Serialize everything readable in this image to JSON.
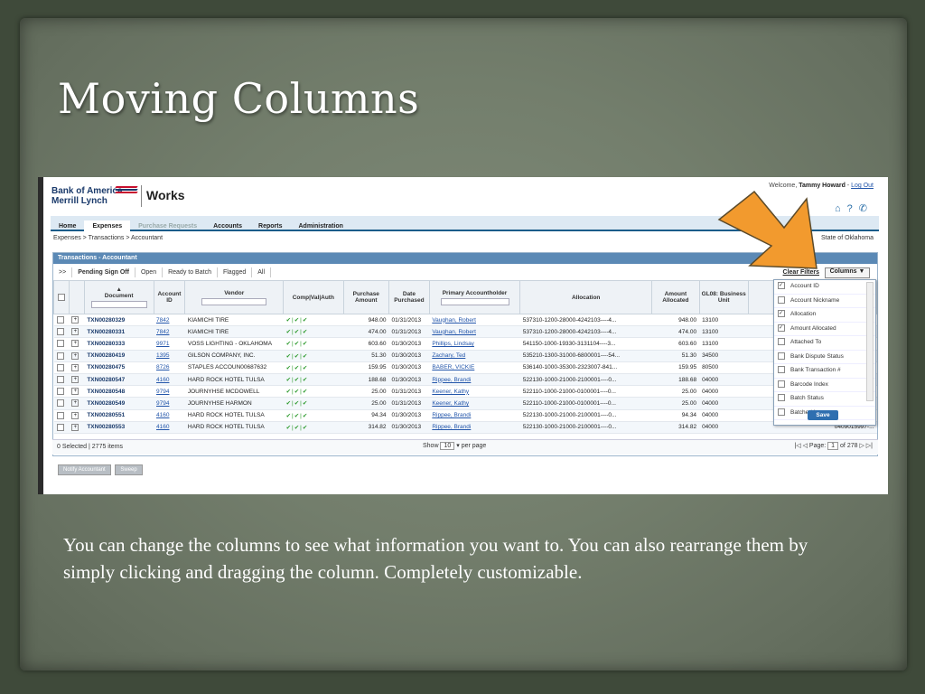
{
  "slide": {
    "title": "Moving Columns",
    "caption": "You can change the columns to see what information you want to. You can also rearrange them by simply clicking and dragging the column. Completely customizable."
  },
  "app": {
    "brand_line1": "Bank of America",
    "brand_line2": "Merrill Lynch",
    "product": "Works",
    "welcome_prefix": "Welcome,",
    "user": "Tammy Howard",
    "logout": "Log Out",
    "nav": [
      "Home",
      "Expenses",
      "Purchase Requests",
      "Accounts",
      "Reports",
      "Administration"
    ],
    "breadcrumb": "Expenses > Transactions > Accountant",
    "state": "State of Oklahoma",
    "panel_title": "Transactions - Accountant",
    "subtabs": [
      ">>",
      "Pending Sign Off",
      "Open",
      "Ready to Batch",
      "Flagged",
      "All"
    ],
    "clear_filters": "Clear Filters",
    "columns_button": "Columns ▼",
    "headers": [
      "Document",
      "Account ID",
      "Vendor",
      "Comp|Val|Auth",
      "Purchase Amount",
      "Date Purchased",
      "Primary Accountholder",
      "Allocation",
      "Amount Allocated",
      "GL08: Business Unit"
    ],
    "rows": [
      [
        "TXN00280329",
        "7842",
        "KIAMICHI TIRE",
        "948.00",
        "01/31/2013",
        "Vaughan, Robert",
        "537310-1200-28000-4242103----4...",
        "948.00",
        "13100"
      ],
      [
        "TXN00280331",
        "7842",
        "KIAMICHI TIRE",
        "474.00",
        "01/31/2013",
        "Vaughan, Robert",
        "537310-1200-28000-4242103----4...",
        "474.00",
        "13100"
      ],
      [
        "TXN00280333",
        "9971",
        "VOSS LIGHTING - OKLAHOMA",
        "603.60",
        "01/30/2013",
        "Phillips, Lindsay",
        "541150-1000-19330-3131104----3...",
        "603.60",
        "13100"
      ],
      [
        "TXN00280419",
        "1395",
        "GILSON COMPANY, INC.",
        "51.30",
        "01/30/2013",
        "Zachary, Ted",
        "535210-1300-31000-6800001----54...",
        "51.30",
        "34500"
      ],
      [
        "TXN00280475",
        "8726",
        "STAPLES ACCOUN00687632",
        "159.95",
        "01/30/2013",
        "BABER, VICKIE",
        "536140-1000-35300-2323007-841...",
        "159.95",
        "80500"
      ],
      [
        "TXN00280547",
        "4160",
        "HARD ROCK HOTEL TULSA",
        "188.68",
        "01/30/2013",
        "Rippee, Brandi",
        "522130-1000-21000-2100001----0...",
        "188.68",
        "04000"
      ],
      [
        "TXN00280548",
        "9794",
        "JOURNYHSE MCDOWELL",
        "25.00",
        "01/31/2013",
        "Keener, Kathy",
        "522110-1000-21000-0100001----0...",
        "25.00",
        "04000"
      ],
      [
        "TXN00280549",
        "9794",
        "JOURNYHSE HARMON",
        "25.00",
        "01/31/2013",
        "Keener, Kathy",
        "522110-1000-21000-0100001----0...",
        "25.00",
        "04000"
      ],
      [
        "TXN00280551",
        "4160",
        "HARD ROCK HOTEL TULSA",
        "94.34",
        "01/30/2013",
        "Rippee, Brandi",
        "522130-1000-21000-2100001----0...",
        "94.34",
        "04000"
      ],
      [
        "TXN00280553",
        "4160",
        "HARD ROCK HOTEL TULSA",
        "314.82",
        "01/30/2013",
        "Rippee, Brandi",
        "522130-1000-21000-2100001----0...",
        "314.82",
        "04000"
      ]
    ],
    "truncated_value": "0409015997-...",
    "selection_status": "0 Selected | 2775 items",
    "show_label": "Show",
    "per_page_value": "10",
    "per_page_label": "per page",
    "page_label": "Page:",
    "page_value": "1",
    "page_total": "of 278",
    "action_buttons": [
      "Notify Accountant",
      "Sweep"
    ],
    "column_menu": [
      {
        "label": "Account ID",
        "checked": true
      },
      {
        "label": "Account Nickname",
        "checked": false
      },
      {
        "label": "Allocation",
        "checked": true
      },
      {
        "label": "Amount Allocated",
        "checked": true
      },
      {
        "label": "Attached To",
        "checked": false
      },
      {
        "label": "Bank Dispute Status",
        "checked": false
      },
      {
        "label": "Bank Transaction #",
        "checked": false
      },
      {
        "label": "Barcode Index",
        "checked": false
      },
      {
        "label": "Batch Status",
        "checked": false
      },
      {
        "label": "Batched In",
        "checked": false
      }
    ],
    "save_label": "Save",
    "arrow_color": "#f29a2e"
  }
}
